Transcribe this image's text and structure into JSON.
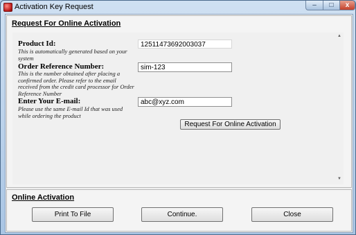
{
  "window": {
    "title": "Activation Key Request",
    "controls": {
      "minimize": "–",
      "maximize": "□",
      "close": "x"
    }
  },
  "request_section": {
    "heading": "Request For Online Activation",
    "product_id": {
      "label": "Product Id:",
      "note": "This is automatically generated based on your system",
      "value": "12511473692003037"
    },
    "order_ref": {
      "label": "Order Reference Number:",
      "note": "This is the number obtained after placing a confirmed order. Please refer to the email received from the credit card processor for Order Reference Number",
      "value": "sim-123"
    },
    "email": {
      "label": "Enter Your E-mail:",
      "note": "Please use the same E-mail Id that was used while ordering the product",
      "value": "abc@xyz.com"
    },
    "request_button": "Request For Online Activation"
  },
  "activation_section": {
    "heading": "Online Activation",
    "print_button": "Print To File",
    "continue_button": "Continue.",
    "close_button": "Close"
  }
}
